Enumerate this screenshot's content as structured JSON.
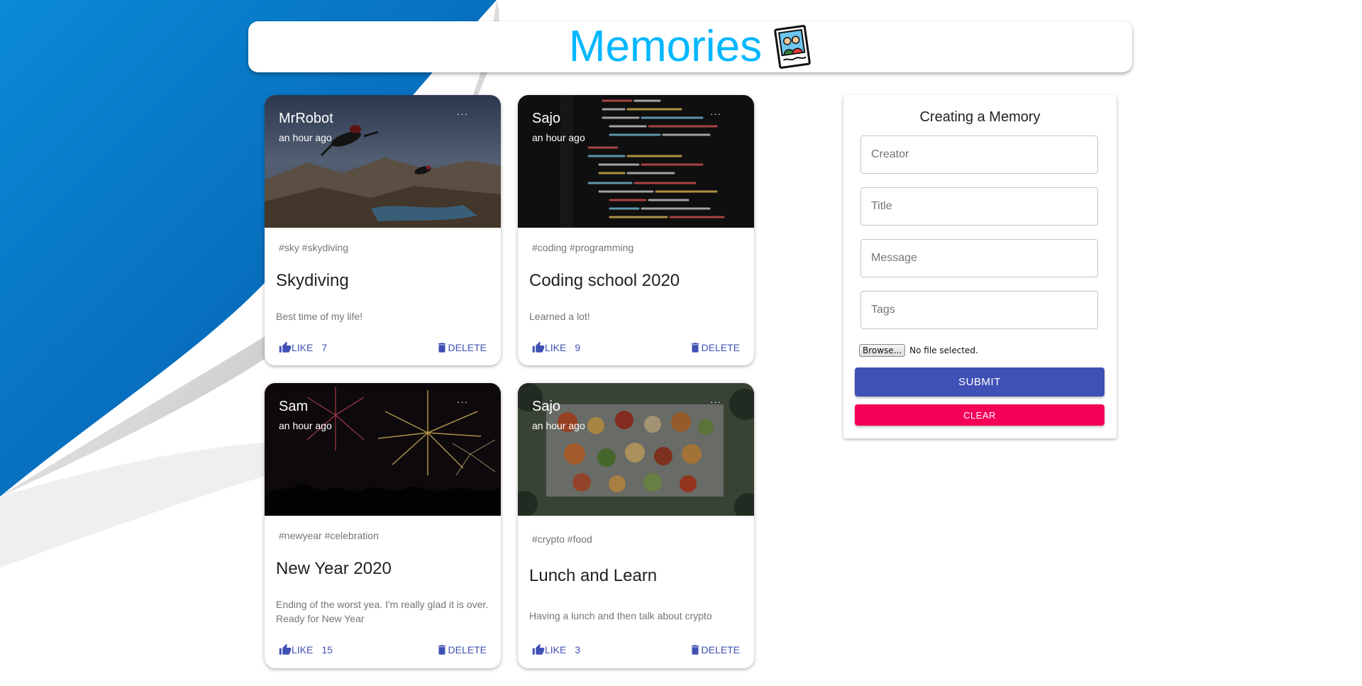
{
  "app": {
    "title": "Memories",
    "logo_icon": "photo-memories-icon",
    "accent_color": "#00b7ff"
  },
  "posts": [
    {
      "creator": "MrRobot",
      "time": "an hour ago",
      "image": "skydivers-over-mountains-lake",
      "tags": "#sky #skydiving",
      "title": "Skydiving",
      "message": "Best time of my life!",
      "like_label": "LIKE",
      "like_count": "7",
      "delete_label": "DELETE",
      "more_label": "···"
    },
    {
      "creator": "Sajo",
      "time": "an hour ago",
      "image": "code-on-dark-screen",
      "tags": "#coding #programming",
      "title": "Coding school 2020",
      "message": "Learned a lot!",
      "like_label": "LIKE",
      "like_count": "9",
      "delete_label": "DELETE",
      "more_label": "···"
    },
    {
      "creator": "Sam",
      "time": "an hour ago",
      "image": "fireworks-night-crowd",
      "tags": "#newyear #celebration",
      "title": "New Year 2020",
      "message": "Ending of the worst yea. I'm really glad it is over. Ready for New Year",
      "like_label": "LIKE",
      "like_count": "15",
      "delete_label": "DELETE",
      "more_label": "···"
    },
    {
      "creator": "Sajo",
      "time": "an hour ago",
      "image": "food-platters-on-table",
      "tags": "#crypto #food",
      "title": "Lunch and Learn",
      "message": "Having a lunch and then talk about crypto",
      "like_label": "LIKE",
      "like_count": "3",
      "delete_label": "DELETE",
      "more_label": "···"
    }
  ],
  "form": {
    "heading": "Creating a Memory",
    "creator_placeholder": "Creator",
    "title_placeholder": "Title",
    "message_placeholder": "Message",
    "tags_placeholder": "Tags",
    "browse_label": "Browse...",
    "file_status": "No file selected.",
    "submit_label": "SUBMIT",
    "clear_label": "CLEAR",
    "submit_color": "#3f51b5",
    "clear_color": "#f50057"
  }
}
